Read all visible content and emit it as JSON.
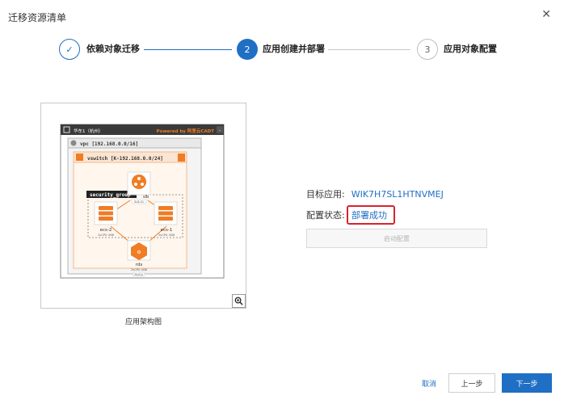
{
  "dialog": {
    "title": "迁移资源清单",
    "close_icon": "close-icon"
  },
  "steps": [
    {
      "label": "依赖对象迁移",
      "status": "done",
      "marker": "✓"
    },
    {
      "label": "应用创建并部署",
      "status": "active",
      "marker": "2"
    },
    {
      "label": "应用对象配置",
      "status": "pending",
      "marker": "3"
    }
  ],
  "diagram": {
    "caption": "应用架构图",
    "region_label": "华东1（杭州）",
    "powered_by": "Powered by 阿里云CADT",
    "vpc_label": "vpc [192.168.0.0/16]",
    "vswitch_label": "vswitch [K-192.168.0.0/24]",
    "security_group_label": "security_group",
    "slb_label": "slb",
    "slb_spec": "SLB.S1",
    "ecs2_label": "ecs-2",
    "ecs2_spec": "2vCPU 4GB",
    "ecs1_label": "ecs-1",
    "ecs1_spec": "2vCPU 4GB",
    "rds_label": "rds",
    "rds_spec": "2vCPU 4GB",
    "rds_tag": "MySQL",
    "zoom_icon": "zoom-in-icon"
  },
  "info": {
    "target_app_label": "目标应用:",
    "target_app_value": "WIK7H7SL1HTNVMEJ",
    "config_status_label": "配置状态:",
    "config_status_value": "部署成功",
    "start_config_button": "启动配置"
  },
  "footer": {
    "cancel": "取消",
    "prev": "上一步",
    "next": "下一步"
  },
  "colors": {
    "primary": "#1f6fc5",
    "orange": "#f07c24",
    "highlight_red": "#d9232d"
  }
}
